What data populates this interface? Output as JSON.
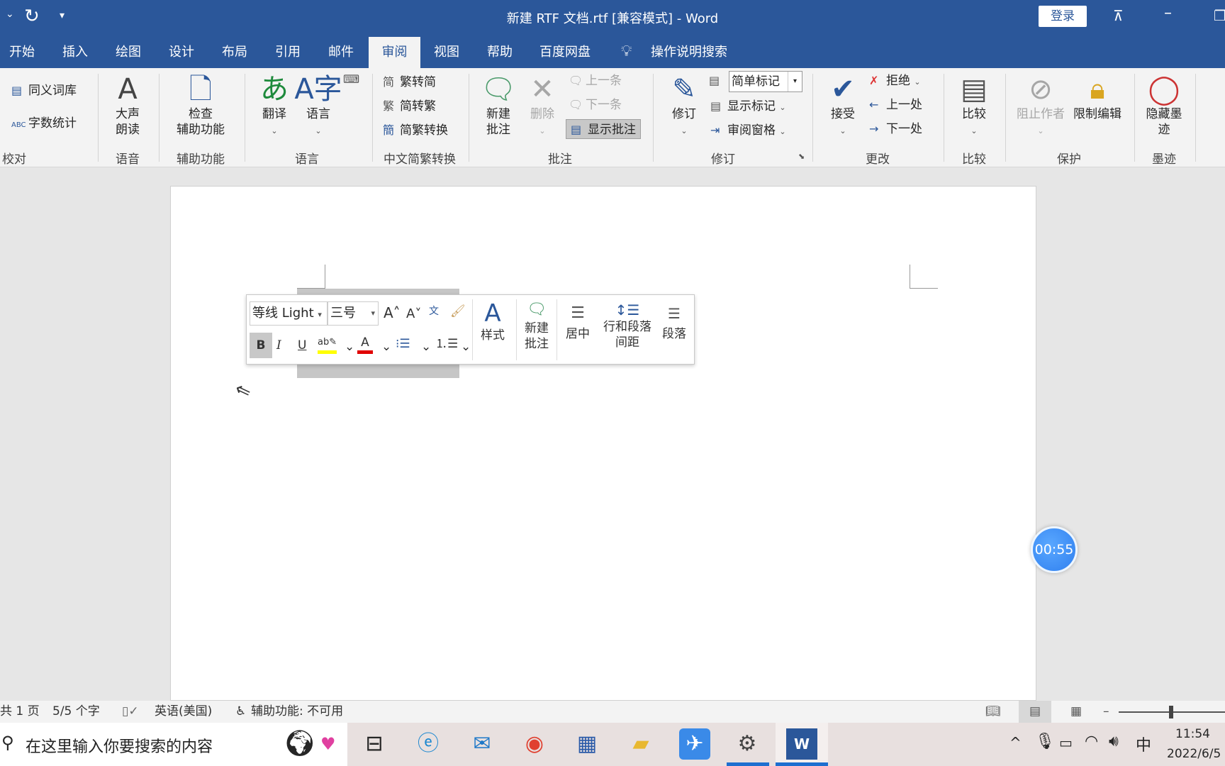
{
  "titlebar": {
    "title": "新建 RTF 文档.rtf [兼容模式]  -  Word",
    "login": "登录",
    "qat_more": "⌄",
    "undo_icon": "redo-icon"
  },
  "tabs": [
    {
      "label": "开始"
    },
    {
      "label": "插入"
    },
    {
      "label": "绘图"
    },
    {
      "label": "设计"
    },
    {
      "label": "布局"
    },
    {
      "label": "引用"
    },
    {
      "label": "邮件"
    },
    {
      "label": "审阅",
      "active": true
    },
    {
      "label": "视图"
    },
    {
      "label": "帮助"
    },
    {
      "label": "百度网盘"
    }
  ],
  "tell_me": "操作说明搜索",
  "ribbon": {
    "proofing": {
      "thesaurus": "同义词库",
      "wordcount": "字数统计",
      "label": "校对"
    },
    "speech": {
      "read_aloud": "大声\n朗读",
      "label": "语音"
    },
    "accessibility": {
      "check": "检查\n辅助功能",
      "label": "辅助功能"
    },
    "language": {
      "translate": "翻译",
      "language": "语言",
      "label": "语言"
    },
    "chinese": {
      "to_simplified": "繁转简",
      "to_traditional": "简转繁",
      "convert": "简繁转换",
      "label": "中文简繁转换"
    },
    "comments": {
      "new": "新建\n批注",
      "delete": "删除",
      "prev": "上一条",
      "next": "下一条",
      "show": "显示批注",
      "label": "批注"
    },
    "tracking": {
      "track": "修订",
      "markup_select": "简单标记",
      "show_markup": "显示标记",
      "review_pane": "审阅窗格",
      "label": "修订"
    },
    "changes": {
      "accept": "接受",
      "reject": "拒绝",
      "prev": "上一处",
      "next": "下一处",
      "label": "更改"
    },
    "compare": {
      "compare": "比较",
      "label": "比较"
    },
    "protect": {
      "block": "阻止作者",
      "restrict": "限制编辑",
      "label": "保护"
    },
    "ink": {
      "hide": "隐藏墨\n迹",
      "label": "墨迹"
    }
  },
  "mini_toolbar": {
    "font": "等线 Light",
    "size": "三号",
    "styles": "样式",
    "new_comment": "新建\n批注",
    "center": "居中",
    "spacing": "行和段落\n间距",
    "paragraph": "段落",
    "highlight_color": "#ffff00",
    "font_color": "#e00000"
  },
  "timer": "00:55",
  "status": {
    "page": "共 1 页",
    "words": "5/5 个字",
    "language": "英语(美国)",
    "accessibility": "辅助功能: 不可用"
  },
  "taskbar": {
    "search_placeholder": "在这里输入你要搜索的内容",
    "ime": "中",
    "time": "11:54",
    "date": "2022/6/5"
  }
}
